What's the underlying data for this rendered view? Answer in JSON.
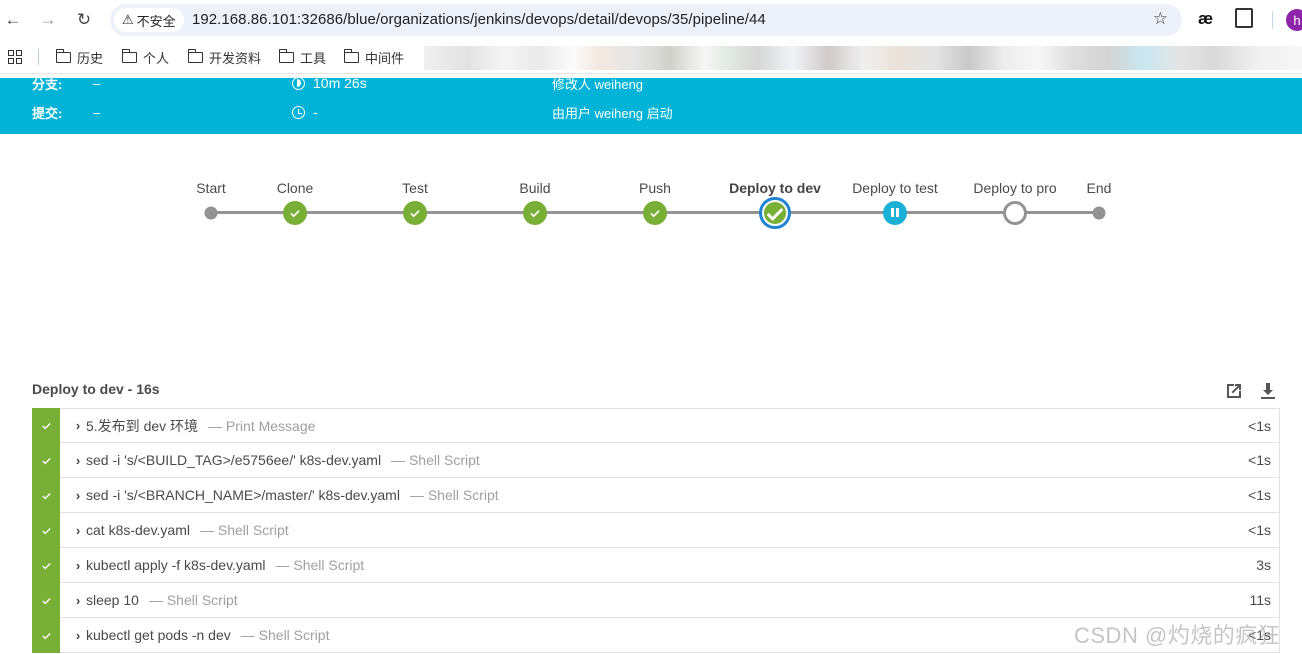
{
  "browser": {
    "security_label": "不安全",
    "url": "192.168.86.101:32686/blue/organizations/jenkins/devops/detail/devops/35/pipeline/44",
    "extension_label": "æ",
    "profile_initial": "h",
    "bookmarks": [
      "历史",
      "个人",
      "开发资料",
      "工具",
      "中间件"
    ]
  },
  "header": {
    "branch_label": "分支:",
    "branch_value": "–",
    "commit_label": "提交:",
    "commit_value": "–",
    "duration": "10m 26s",
    "started": "-",
    "changes": "修改人 weiheng",
    "cause": "由用户 weiheng 启动"
  },
  "pipeline": {
    "stages": [
      {
        "name": "Start",
        "status": "start"
      },
      {
        "name": "Clone",
        "status": "success"
      },
      {
        "name": "Test",
        "status": "success"
      },
      {
        "name": "Build",
        "status": "success"
      },
      {
        "name": "Push",
        "status": "success"
      },
      {
        "name": "Deploy to dev",
        "status": "success",
        "selected": true
      },
      {
        "name": "Deploy to test",
        "status": "paused"
      },
      {
        "name": "Deploy to pro",
        "status": "not_built"
      },
      {
        "name": "End",
        "status": "end"
      }
    ]
  },
  "steps_panel": {
    "title": "Deploy to dev - 16s",
    "open_icon": "external-link-icon",
    "download_icon": "download-icon",
    "steps": [
      {
        "name": "5.发布到 dev 环境",
        "type": "— Print Message",
        "duration": "<1s"
      },
      {
        "name": "sed -i 's/<BUILD_TAG>/e5756ee/' k8s-dev.yaml",
        "type": "— Shell Script",
        "duration": "<1s"
      },
      {
        "name": "sed -i 's/<BRANCH_NAME>/master/' k8s-dev.yaml",
        "type": "— Shell Script",
        "duration": "<1s"
      },
      {
        "name": "cat k8s-dev.yaml",
        "type": "— Shell Script",
        "duration": "<1s"
      },
      {
        "name": "kubectl apply -f k8s-dev.yaml",
        "type": "— Shell Script",
        "duration": "3s"
      },
      {
        "name": "sleep 10",
        "type": "— Shell Script",
        "duration": "11s"
      },
      {
        "name": "kubectl get pods -n dev",
        "type": "— Shell Script",
        "duration": "<1s"
      }
    ]
  },
  "watermark": "CSDN @灼烧的疯狂"
}
